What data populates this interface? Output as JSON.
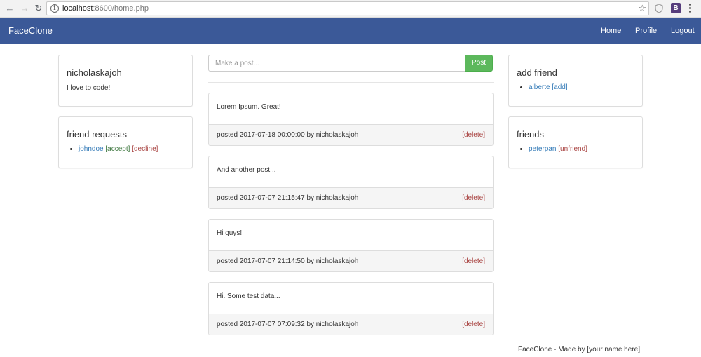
{
  "browser": {
    "url_host": "localhost",
    "url_rest": ":8600/home.php",
    "ext_b_label": "B"
  },
  "navbar": {
    "brand": "FaceClone",
    "links": [
      "Home",
      "Profile",
      "Logout"
    ],
    "bg_color": "#3b5998"
  },
  "profile": {
    "username": "nicholaskajoh",
    "bio": "I love to code!"
  },
  "friend_requests": {
    "title": "friend requests",
    "items": [
      {
        "name": "johndoe",
        "accept": "[accept]",
        "decline": "[decline]"
      }
    ]
  },
  "post_form": {
    "placeholder": "Make a post...",
    "button": "Post"
  },
  "posts": [
    {
      "content": "Lorem Ipsum. Great!",
      "meta": "posted 2017-07-18 00:00:00 by nicholaskajoh",
      "delete": "[delete]"
    },
    {
      "content": "And another post...",
      "meta": "posted 2017-07-07 21:15:47 by nicholaskajoh",
      "delete": "[delete]"
    },
    {
      "content": "Hi guys!",
      "meta": "posted 2017-07-07 21:14:50 by nicholaskajoh",
      "delete": "[delete]"
    },
    {
      "content": "Hi. Some test data...",
      "meta": "posted 2017-07-07 07:09:32 by nicholaskajoh",
      "delete": "[delete]"
    }
  ],
  "add_friend": {
    "title": "add friend",
    "items": [
      {
        "name": "alberte",
        "action": "[add]"
      }
    ]
  },
  "friends": {
    "title": "friends",
    "items": [
      {
        "name": "peterpan",
        "action": "[unfriend]"
      }
    ]
  },
  "footer": "FaceClone - Made by [your name here]"
}
